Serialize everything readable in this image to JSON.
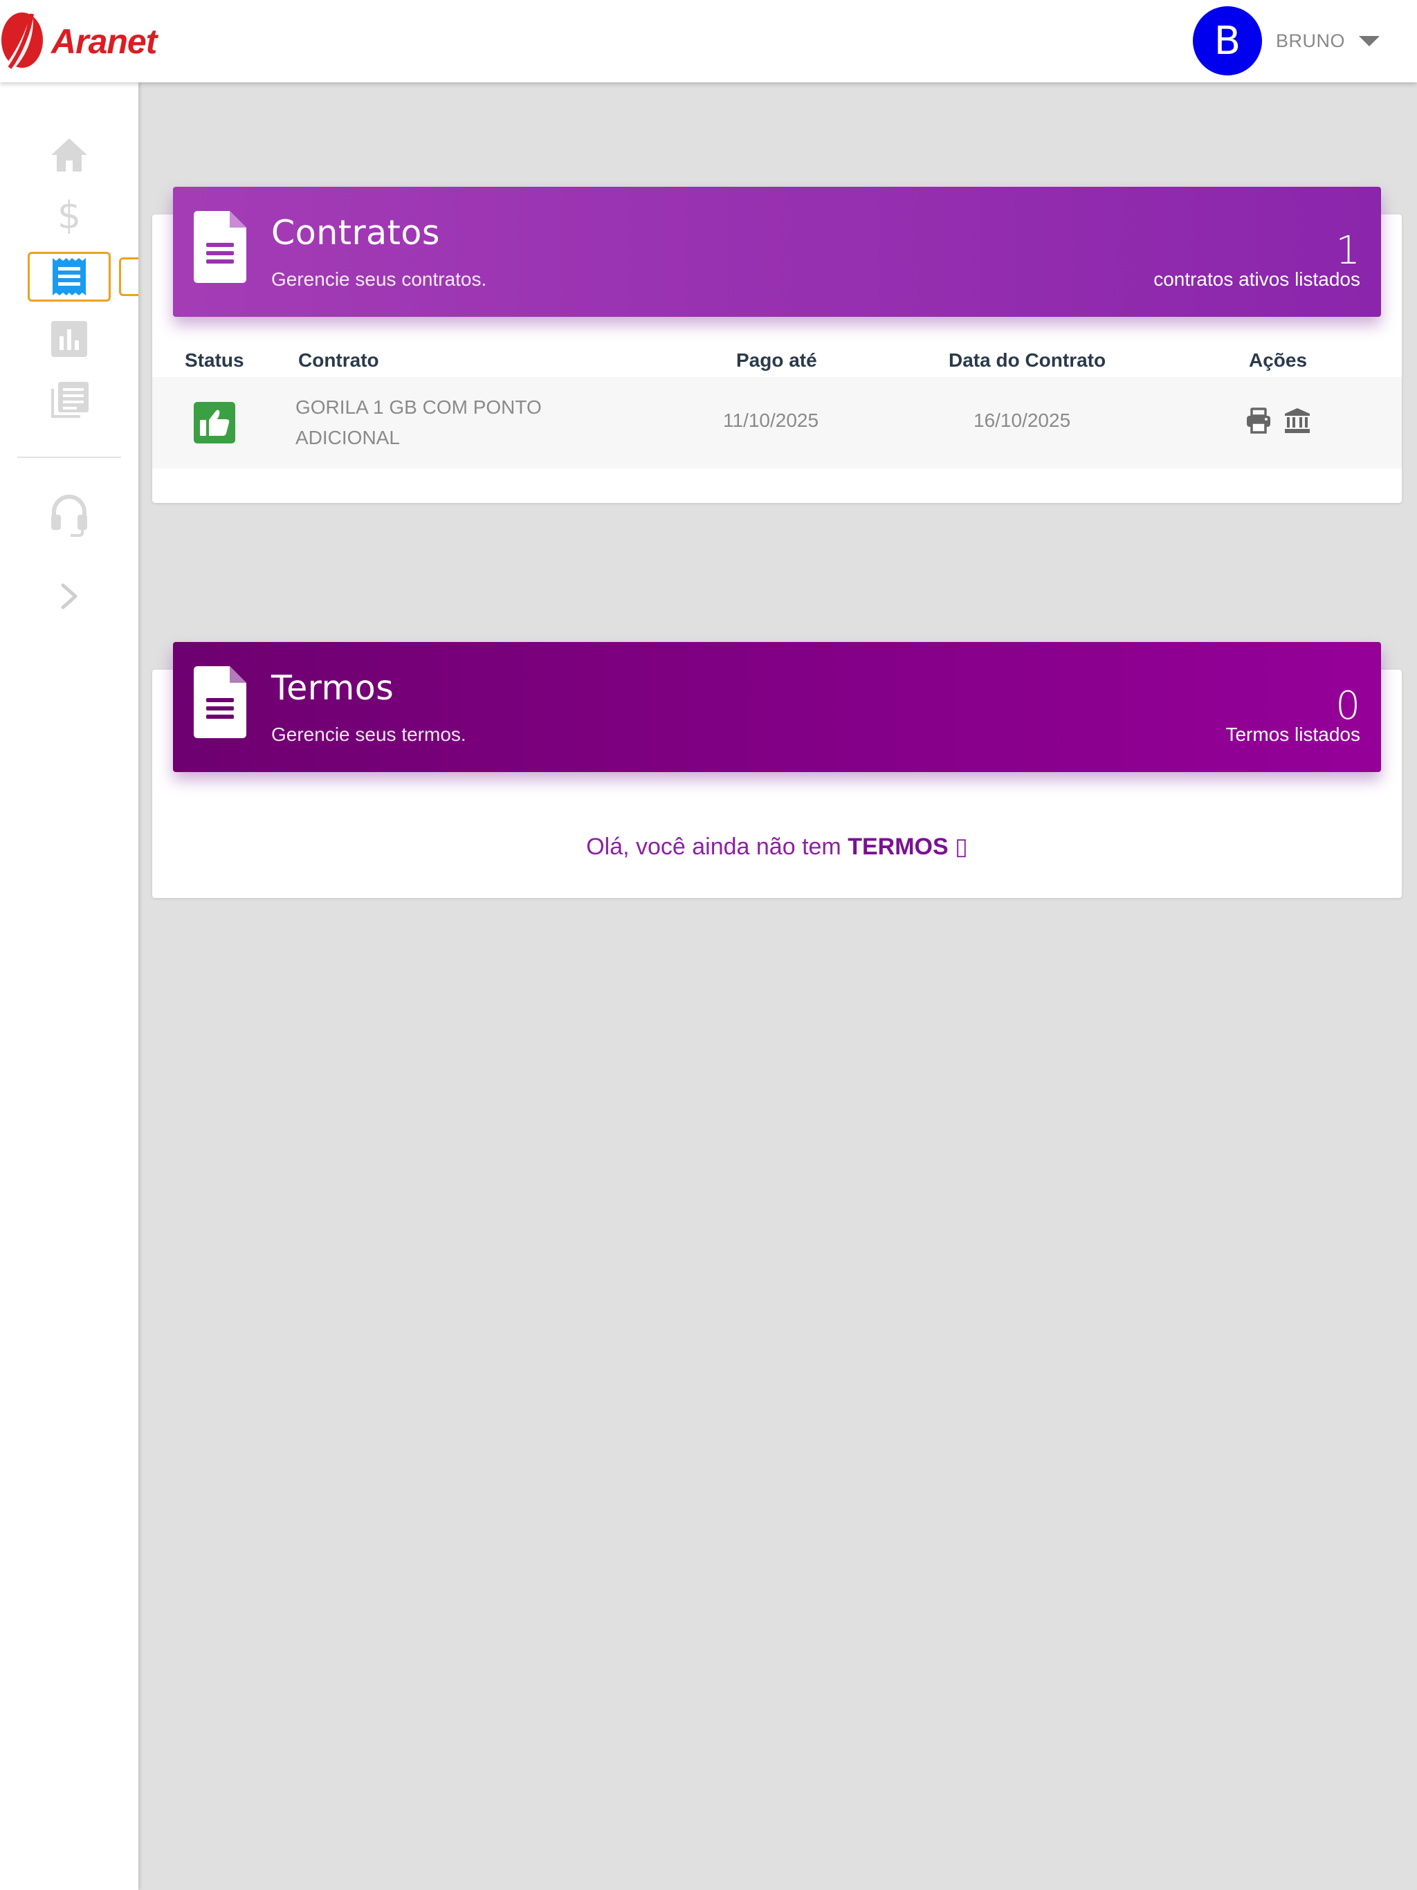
{
  "brand": {
    "name": "Aranet",
    "color": "#d91e24"
  },
  "user": {
    "initial": "B",
    "name": "BRUNO",
    "avatar_color": "#0000ee"
  },
  "sidebar": {
    "items": [
      {
        "name": "home",
        "icon": "home-icon"
      },
      {
        "name": "financeiro",
        "icon": "dollar-icon"
      },
      {
        "name": "contratos",
        "icon": "receipt-icon",
        "active": true
      },
      {
        "name": "consumo",
        "icon": "bar-chart-icon"
      },
      {
        "name": "documentos",
        "icon": "library-icon"
      },
      {
        "name": "suporte",
        "icon": "headset-icon"
      },
      {
        "name": "expandir",
        "icon": "chevron-right-icon"
      }
    ]
  },
  "contracts": {
    "title": "Contratos",
    "subtitle": "Gerencie seus contratos.",
    "count": "1",
    "count_label": "contratos ativos listados",
    "columns": {
      "status": "Status",
      "contract": "Contrato",
      "paid_until": "Pago até",
      "contract_date": "Data do Contrato",
      "actions": "Ações"
    },
    "rows": [
      {
        "status": "ativo",
        "status_icon": "thumbs-up-icon",
        "contract": "GORILA 1 GB COM PONTO ADICIONAL",
        "paid_until": "11/10/2025",
        "contract_date": "16/10/2025",
        "actions": [
          "printer-icon",
          "bank-icon"
        ]
      }
    ]
  },
  "terms": {
    "title": "Termos",
    "subtitle": "Gerencie seus termos.",
    "count": "0",
    "count_label": "Termos listados",
    "empty_prefix": "Olá, você ainda não tem ",
    "empty_strong": "TERMOS",
    "empty_suffix": " ▯"
  },
  "colors": {
    "contracts_header_start": "#a43cb6",
    "contracts_header_end": "#8b25ab",
    "terms_header_start": "#6e0070",
    "terms_header_end": "#950099",
    "status_active": "#3aa043",
    "active_outline": "#f0a020"
  }
}
